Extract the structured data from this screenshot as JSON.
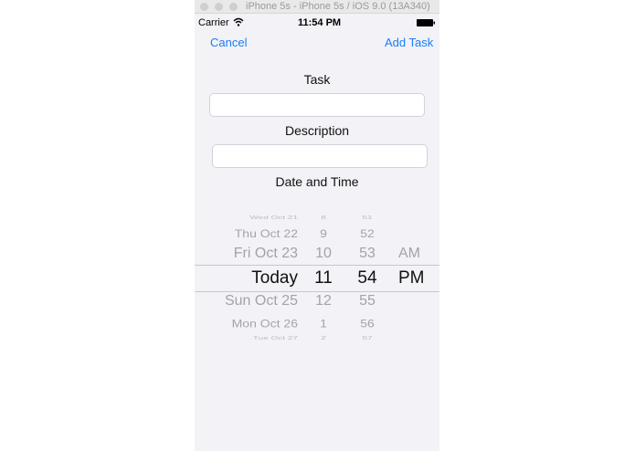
{
  "window": {
    "title": "iPhone 5s - iPhone 5s / iOS 9.0 (13A340)"
  },
  "status_bar": {
    "carrier": "Carrier",
    "time": "11:54 PM"
  },
  "nav": {
    "cancel": "Cancel",
    "add_task": "Add Task"
  },
  "form": {
    "task_label": "Task",
    "task_value": "",
    "description_label": "Description",
    "description_value": "",
    "date_label": "Date and Time"
  },
  "picker": {
    "rows": [
      {
        "date": "Wed Oct 21",
        "hour": "8",
        "minute": "51",
        "ampm": ""
      },
      {
        "date": "Thu Oct 22",
        "hour": "9",
        "minute": "52",
        "ampm": ""
      },
      {
        "date": "Fri Oct 23",
        "hour": "10",
        "minute": "53",
        "ampm": "AM"
      },
      {
        "date": "Today",
        "hour": "11",
        "minute": "54",
        "ampm": "PM"
      },
      {
        "date": "Sun Oct 25",
        "hour": "12",
        "minute": "55",
        "ampm": ""
      },
      {
        "date": "Mon Oct 26",
        "hour": "1",
        "minute": "56",
        "ampm": ""
      },
      {
        "date": "Tue Oct 27",
        "hour": "2",
        "minute": "57",
        "ampm": ""
      }
    ],
    "selected_index": 3
  }
}
